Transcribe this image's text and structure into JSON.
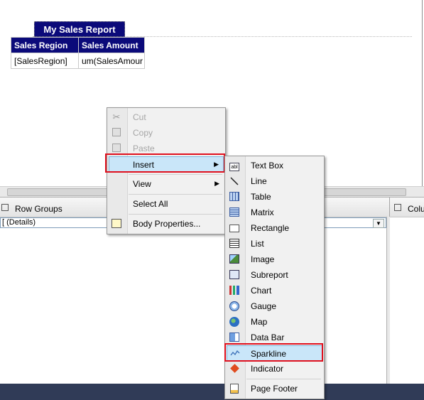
{
  "report": {
    "title": "My Sales Report",
    "headers": [
      "Sales Region",
      "Sales Amount"
    ],
    "cells": [
      "[SalesRegion]",
      "um(SalesAmour"
    ]
  },
  "grouping": {
    "row_groups_label": "Row Groups",
    "column_groups_label": "Colu",
    "details_value": "[ (Details)",
    "dropdown_glyph": "▼"
  },
  "context_menu": {
    "items": [
      {
        "label": "Cut",
        "enabled": false,
        "icon": "scissors-icon"
      },
      {
        "label": "Copy",
        "enabled": false,
        "icon": "copy-icon"
      },
      {
        "label": "Paste",
        "enabled": false,
        "icon": "paste-icon"
      },
      {
        "label": "Insert",
        "enabled": true,
        "submenu": true,
        "highlighted": true
      },
      {
        "label": "View",
        "enabled": true,
        "submenu": true
      },
      {
        "label": "Select All",
        "enabled": true
      },
      {
        "label": "Body Properties...",
        "enabled": true,
        "icon": "body-properties-icon"
      }
    ],
    "arrow_glyph": "▶"
  },
  "insert_submenu": {
    "items": [
      {
        "label": "Text Box",
        "icon": "textbox-icon"
      },
      {
        "label": "Line",
        "icon": "line-icon"
      },
      {
        "label": "Table",
        "icon": "table-icon"
      },
      {
        "label": "Matrix",
        "icon": "matrix-icon"
      },
      {
        "label": "Rectangle",
        "icon": "rectangle-icon"
      },
      {
        "label": "List",
        "icon": "list-icon"
      },
      {
        "label": "Image",
        "icon": "image-icon"
      },
      {
        "label": "Subreport",
        "icon": "subreport-icon"
      },
      {
        "label": "Chart",
        "icon": "chart-icon"
      },
      {
        "label": "Gauge",
        "icon": "gauge-icon"
      },
      {
        "label": "Map",
        "icon": "map-icon"
      },
      {
        "label": "Data Bar",
        "icon": "data-bar-icon"
      },
      {
        "label": "Sparkline",
        "icon": "sparkline-icon",
        "highlighted": true
      },
      {
        "label": "Indicator",
        "icon": "indicator-icon"
      },
      {
        "label": "Page Footer",
        "icon": "page-footer-icon"
      }
    ],
    "textbox_glyph": "abl"
  },
  "colors": {
    "header_bg": "#0b0a7a",
    "highlight_bg": "#c9e6f9",
    "annotation_red": "#e0101e",
    "status_bar": "#303b57"
  }
}
